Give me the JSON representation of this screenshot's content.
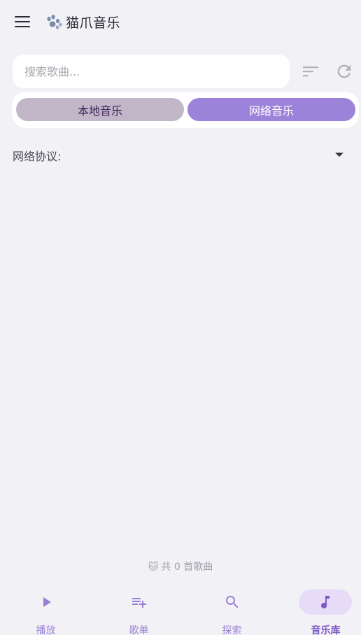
{
  "app": {
    "title": "猫爪音乐"
  },
  "search": {
    "placeholder": "搜索歌曲..."
  },
  "segment": {
    "local_label": "本地音乐",
    "network_label": "网络音乐",
    "selected": "network"
  },
  "protocol": {
    "label": "网络协议:",
    "selected_value": ""
  },
  "song_count": {
    "text": "共 0 首歌曲",
    "emoji": "🐱"
  },
  "bottom_nav": {
    "items": [
      {
        "label": "播放",
        "icon": "play-icon",
        "active": false
      },
      {
        "label": "歌单",
        "icon": "playlist-add-icon",
        "active": false
      },
      {
        "label": "探索",
        "icon": "search-icon",
        "active": false
      },
      {
        "label": "音乐库",
        "icon": "music-note-icon",
        "active": true
      }
    ]
  },
  "colors": {
    "background": "#f1f1f6",
    "accent": "#9d82d9",
    "accent_dark": "#7e58c7",
    "segment_inactive": "#c1b7c9",
    "nav_active_pill": "#e6dcf8"
  }
}
